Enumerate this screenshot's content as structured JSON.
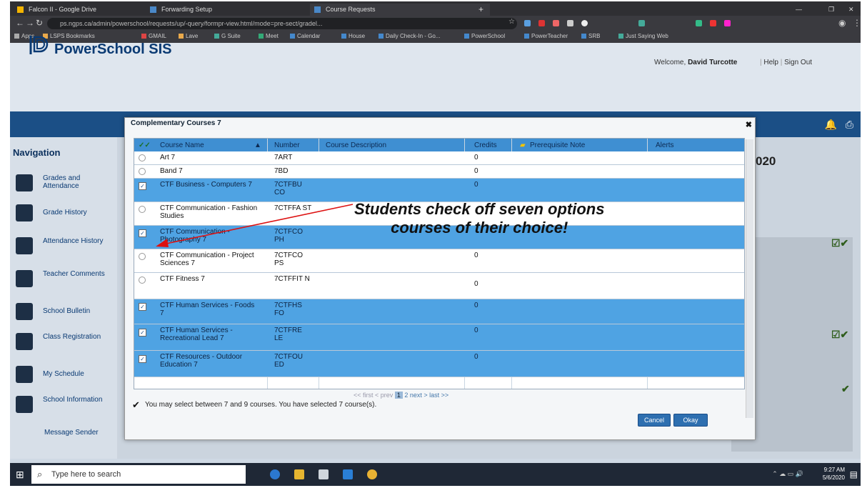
{
  "browser": {
    "tabs": [
      {
        "label": "Falcon II - Google Drive"
      },
      {
        "label": "Forwarding Setup"
      },
      {
        "label": "Course Requests"
      }
    ],
    "new_tab": "+",
    "url": "ps.ngps.ca/admin/powerschool/requests/up/-query/formpr-view.html/mode=pre-sect/gradel...",
    "bookmarks": [
      "Apps",
      "LSPS Bookmarks",
      "GMAIL",
      "Lave",
      "G Suite",
      "Meet",
      "Calendar",
      "House",
      "Daily Check-In - Go...",
      "PowerSchool",
      "PowerTeacher",
      "SRB",
      "Just Saying Web"
    ]
  },
  "header": {
    "logo": "PowerSchool SIS",
    "welcome_prefix": "Welcome,",
    "user": "David Turcotte",
    "help": "Help",
    "sign_out": "Sign Out",
    "year_fragment": "020"
  },
  "navigation": {
    "title": "Navigation",
    "items": [
      {
        "label": "Grades and Attendance"
      },
      {
        "label": "Grade History"
      },
      {
        "label": "Attendance History"
      },
      {
        "label": "Teacher Comments"
      },
      {
        "label": "School Bulletin"
      },
      {
        "label": "Class Registration"
      },
      {
        "label": "My Schedule"
      },
      {
        "label": "School Information"
      },
      {
        "label": "Message Sender"
      }
    ]
  },
  "modal": {
    "title": "Complementary Courses 7",
    "columns": [
      "Course Name",
      "Number",
      "Course Description",
      "Credits",
      "Prerequisite Note",
      "Alerts"
    ],
    "rows": [
      {
        "name": "Art 7",
        "number": "7ART",
        "credits": "0",
        "selected": false
      },
      {
        "name": "Band 7",
        "number": "7BD",
        "credits": "0",
        "selected": false
      },
      {
        "name": "CTF Business - Computers 7",
        "number": "7CTFBU CO",
        "credits": "0",
        "selected": true
      },
      {
        "name": "CTF Communication - Fashion Studies",
        "number": "7CTFFA ST",
        "credits": "",
        "selected": false
      },
      {
        "name": "CTF Communication - Photography 7",
        "number": "7CTFCO PH",
        "credits": "",
        "selected": true
      },
      {
        "name": "CTF Communication - Project Sciences 7",
        "number": "7CTFCO PS",
        "credits": "0",
        "selected": false
      },
      {
        "name": "CTF Fitness 7",
        "number": "7CTFFIT N",
        "credits": "0",
        "selected": false
      },
      {
        "name": "CTF Human Services - Foods 7",
        "number": "7CTFHS FO",
        "credits": "0",
        "selected": true
      },
      {
        "name": "CTF Human Services - Recreational Lead 7",
        "number": "7CTFRE LE",
        "credits": "0",
        "selected": true
      },
      {
        "name": "CTF Resources - Outdoor Education 7",
        "number": "7CTFOU ED",
        "credits": "0",
        "selected": true
      }
    ],
    "pager": {
      "first": "<< first",
      "prev": "< prev",
      "page1": "1",
      "page2": "2",
      "next": "next >",
      "last": "last >>"
    },
    "note": "You may select between 7 and 9 courses.  You have selected 7 course(s).",
    "cancel": "Cancel",
    "okay": "Okay"
  },
  "annotation": {
    "line1": "Students check off seven options",
    "line2": "courses of their choice!"
  },
  "taskbar": {
    "search_placeholder": "Type here to search",
    "time": "9:27 AM",
    "date": "5/6/2020"
  },
  "colors": {
    "selected_row": "#4fa3e3",
    "header_bar": "#1b4f86",
    "logo": "#0a3a73"
  }
}
